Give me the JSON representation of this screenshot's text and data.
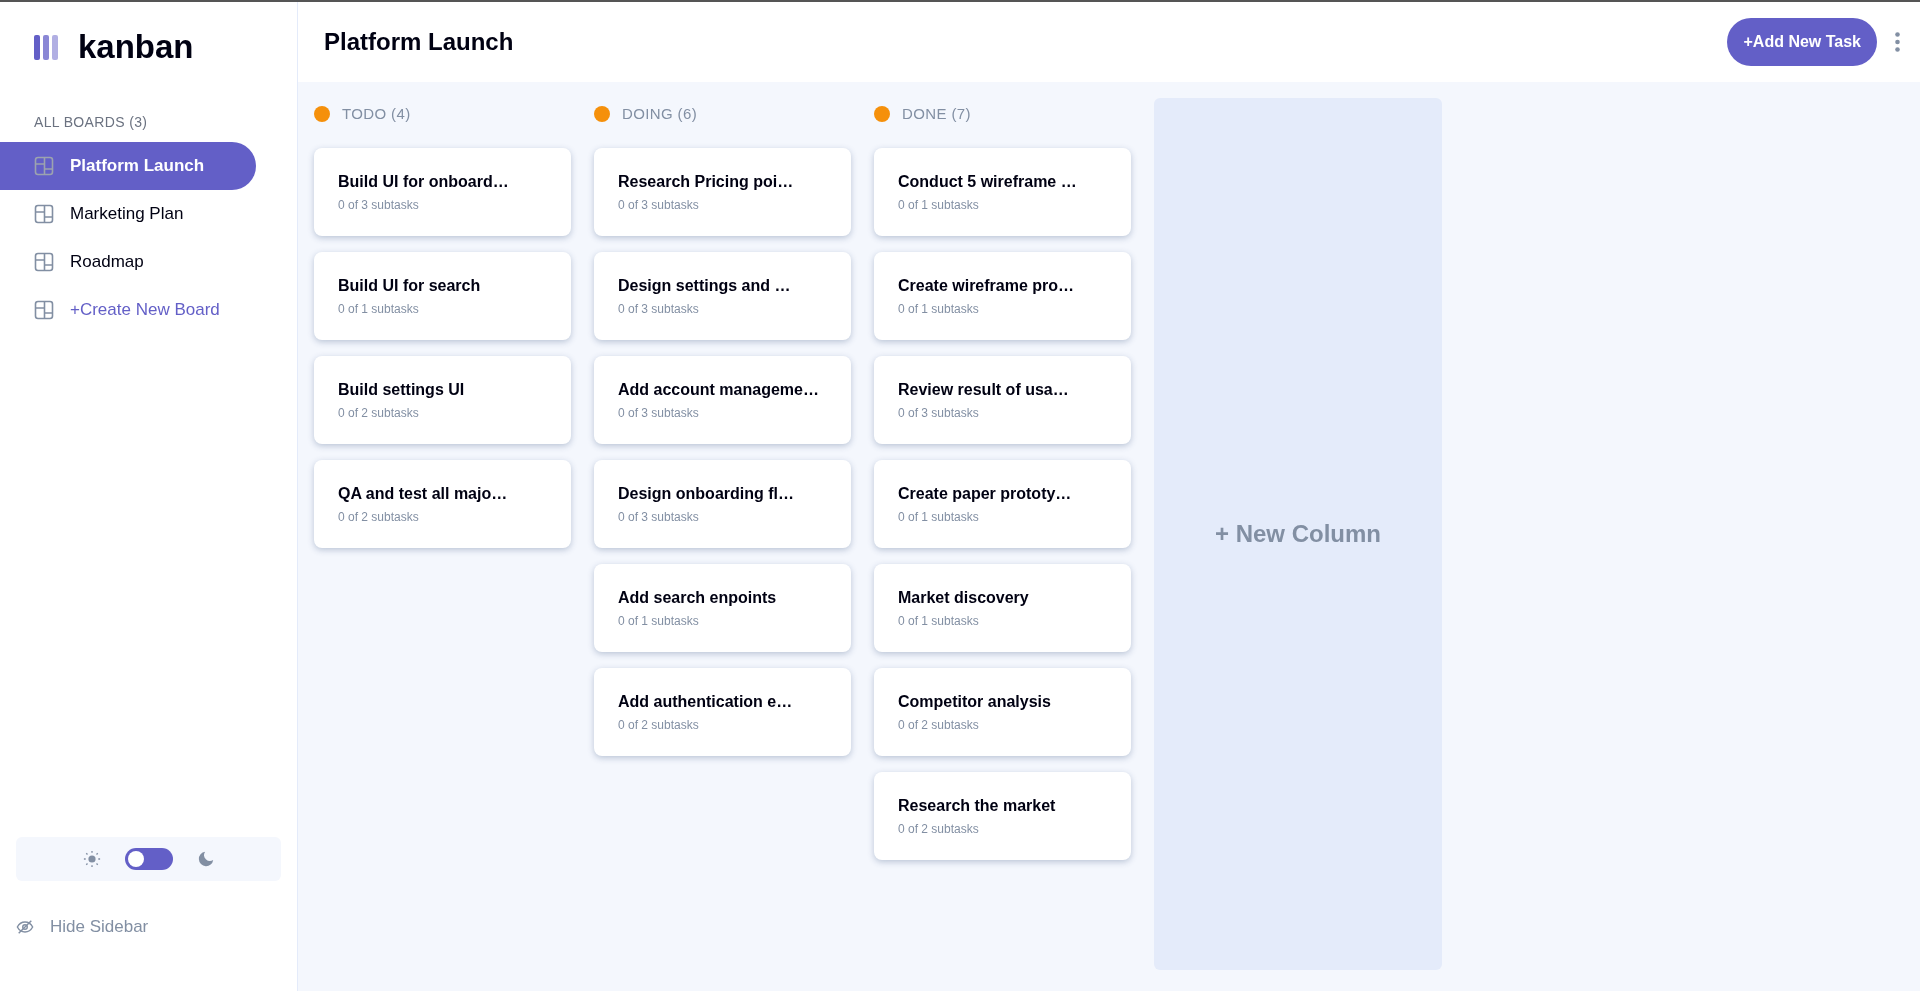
{
  "logo": {
    "text": "kanban"
  },
  "sidebar": {
    "heading": "ALL BOARDS (3)",
    "boards": [
      {
        "label": "Platform Launch",
        "selected": true
      },
      {
        "label": "Marketing Plan",
        "selected": false
      },
      {
        "label": "Roadmap",
        "selected": false
      }
    ],
    "create_board": "+Create New Board",
    "theme_toggle": {
      "dark": false
    },
    "hide_sidebar": "Hide Sidebar"
  },
  "header": {
    "title": "Platform Launch",
    "add_task": "+Add New Task"
  },
  "columns": [
    {
      "title": "TODO (4)",
      "color": "#f5900b",
      "tasks": [
        {
          "title": "Build UI for onboard…",
          "subtasks": "0 of 3 subtasks"
        },
        {
          "title": "Build UI for search",
          "subtasks": "0 of 1 subtasks"
        },
        {
          "title": "Build settings UI",
          "subtasks": "0 of 2 subtasks"
        },
        {
          "title": "QA and test all majo…",
          "subtasks": "0 of 2 subtasks"
        }
      ]
    },
    {
      "title": "DOING (6)",
      "color": "#f5900b",
      "tasks": [
        {
          "title": "Research Pricing poi…",
          "subtasks": "0 of 3 subtasks"
        },
        {
          "title": "Design settings and …",
          "subtasks": "0 of 3 subtasks"
        },
        {
          "title": "Add account manageme…",
          "subtasks": "0 of 3 subtasks"
        },
        {
          "title": "Design onboarding fl…",
          "subtasks": "0 of 3 subtasks"
        },
        {
          "title": "Add search enpoints",
          "subtasks": "0 of 1 subtasks"
        },
        {
          "title": "Add authentication e…",
          "subtasks": "0 of 2 subtasks"
        }
      ]
    },
    {
      "title": "DONE (7)",
      "color": "#f5900b",
      "tasks": [
        {
          "title": "Conduct 5 wireframe …",
          "subtasks": "0 of 1 subtasks"
        },
        {
          "title": "Create wireframe pro…",
          "subtasks": "0 of 1 subtasks"
        },
        {
          "title": "Review result of usa…",
          "subtasks": "0 of 3 subtasks"
        },
        {
          "title": "Create paper prototy…",
          "subtasks": "0 of 1 subtasks"
        },
        {
          "title": "Market discovery",
          "subtasks": "0 of 1 subtasks"
        },
        {
          "title": "Competitor analysis",
          "subtasks": "0 of 2 subtasks"
        },
        {
          "title": "Research the market",
          "subtasks": "0 of 2 subtasks"
        }
      ]
    }
  ],
  "new_column": "+ New Column"
}
